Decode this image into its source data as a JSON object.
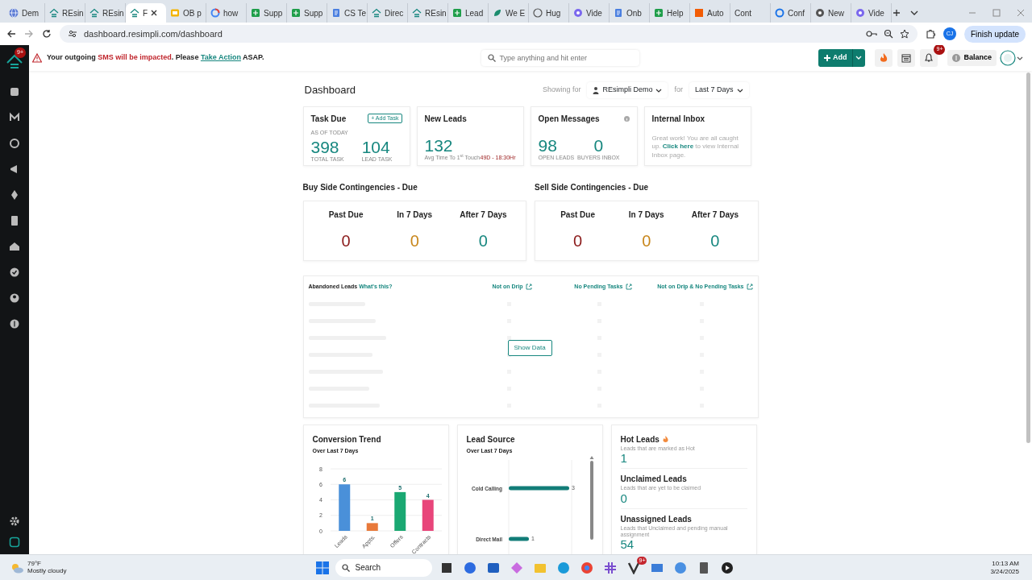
{
  "browser": {
    "tabs": [
      {
        "label": "Dem",
        "kind": "globe",
        "selected": false
      },
      {
        "label": "REsin",
        "kind": "house",
        "selected": false
      },
      {
        "label": "REsin",
        "kind": "house",
        "selected": false
      },
      {
        "label": "F",
        "kind": "house",
        "selected": true
      },
      {
        "label": "OB p",
        "kind": "slides",
        "selected": false
      },
      {
        "label": "how",
        "kind": "google",
        "selected": false
      },
      {
        "label": "Supp",
        "kind": "sheet",
        "selected": false
      },
      {
        "label": "Supp",
        "kind": "sheet",
        "selected": false
      },
      {
        "label": "CS Te",
        "kind": "doc",
        "selected": false
      },
      {
        "label": "Direc",
        "kind": "house",
        "selected": false
      },
      {
        "label": "REsin",
        "kind": "house",
        "selected": false
      },
      {
        "label": "Lead",
        "kind": "sheet",
        "selected": false
      },
      {
        "label": "We E",
        "kind": "leaf",
        "selected": false
      },
      {
        "label": "Hug",
        "kind": "face",
        "selected": false
      },
      {
        "label": "Vide",
        "kind": "flower",
        "selected": false
      },
      {
        "label": "Onb",
        "kind": "doc",
        "selected": false
      },
      {
        "label": "Help",
        "kind": "sheet",
        "selected": false
      },
      {
        "label": "Auto",
        "kind": "square",
        "selected": false
      },
      {
        "label": "Cont",
        "kind": "plain",
        "selected": false
      },
      {
        "label": "Conf",
        "kind": "ring",
        "selected": false
      },
      {
        "label": "New",
        "kind": "chrome",
        "selected": false
      },
      {
        "label": "Vide",
        "kind": "flower",
        "selected": false
      }
    ],
    "address": "dashboard.resimpli.com/dashboard",
    "profile": "CJ",
    "update_button": "Finish update"
  },
  "sidebar": {
    "badge": "9+"
  },
  "alert": {
    "before": "Your outgoing ",
    "highlight": "SMS will be impacted",
    "middle": ". Please ",
    "link": "Take Action",
    "after": " ASAP."
  },
  "header": {
    "search_placeholder": "Type anything and hit enter",
    "add_button": "Add",
    "notification_badge": "9+",
    "balance": "Balance"
  },
  "dashboard": {
    "title": "Dashboard",
    "showing_for": "Showing for",
    "account": "REsimpli Demo",
    "for": "for",
    "period": "Last 7 Days"
  },
  "summary_cards": [
    {
      "kind": "tasks",
      "title": "Task Due",
      "button": "+ Add Task",
      "subtitle": "AS OF TODAY",
      "stats": [
        {
          "value": "398",
          "label": "TOTAL TASK"
        },
        {
          "value": "104",
          "label": "LEAD TASK"
        }
      ]
    },
    {
      "kind": "leads",
      "title": "New Leads",
      "value": "132",
      "note": "Avg Time To 1$^{st}$ Touch",
      "note_value": "49D - 18:30Hr"
    },
    {
      "kind": "messages",
      "title": "Open Messages",
      "stats": [
        {
          "value": "98",
          "label": "OPEN LEADS"
        },
        {
          "value": "0",
          "label": "BUYERS INBOX"
        }
      ]
    },
    {
      "kind": "inbox",
      "title": "Internal Inbox",
      "before": "Great work! You are all caught up. ",
      "link": "Click here",
      "after": " to view Internal Inbox page."
    }
  ],
  "contingencies": [
    {
      "title": "Buy Side Contingencies - Due",
      "items": [
        {
          "label": "Past Due",
          "value": "0",
          "color": "#8b1a1a"
        },
        {
          "label": "In 7 Days",
          "value": "0",
          "color": "#c8871c"
        },
        {
          "label": "After 7 Days",
          "value": "0",
          "color": "#17877f"
        }
      ]
    },
    {
      "title": "Sell Side Contingencies - Due",
      "items": [
        {
          "label": "Past Due",
          "value": "0",
          "color": "#8b1a1a"
        },
        {
          "label": "In 7 Days",
          "value": "0",
          "color": "#c8871c"
        },
        {
          "label": "After 7 Days",
          "value": "0",
          "color": "#17877f"
        }
      ]
    }
  ],
  "abandoned": {
    "title": "Abandoned Leads",
    "help_link": "What's this?",
    "columns": [
      "Not on Drip",
      "No Pending Tasks",
      "Not on Drip & No Pending Tasks"
    ],
    "button": "Show Data"
  },
  "conversion": {
    "title": "Conversion Trend",
    "subtitle": "Over Last 7 Days",
    "chart_data": {
      "type": "bar",
      "categories": [
        "Leads",
        "Appts.",
        "Offers",
        "Contracts"
      ],
      "stacked": true,
      "grid": true,
      "data_labels": true,
      "yticks": [
        0,
        2,
        4,
        6,
        8
      ],
      "ylim": [
        0,
        8
      ],
      "series": [
        {
          "color": "#4a90d9",
          "values": [
            6,
            null,
            null,
            null
          ]
        },
        {
          "color": "#e8793a",
          "values": [
            null,
            1,
            null,
            null
          ]
        },
        {
          "color": "#1aa872",
          "values": [
            null,
            null,
            5,
            null
          ]
        },
        {
          "color": "#e8457a",
          "values": [
            null,
            null,
            null,
            4
          ]
        }
      ]
    }
  },
  "lead_source": {
    "title": "Lead Source",
    "subtitle": "Over Last 7 Days",
    "chart_data": {
      "type": "bar",
      "orientation": "horizontal",
      "grid": true,
      "data_labels": true,
      "categories": [
        "Cold Calling",
        "Direct Mail"
      ],
      "series": [
        {
          "color": "#127d78",
          "values": [
            3,
            1
          ]
        }
      ]
    }
  },
  "lead_stats": [
    {
      "title": "Hot Leads",
      "hot": true,
      "description": "Leads that are marked as Hot",
      "value": "1"
    },
    {
      "title": "Unclaimed Leads",
      "hot": false,
      "description": "Leads that are yet to be claimed",
      "value": "0"
    },
    {
      "title": "Unassigned Leads",
      "hot": false,
      "description": "Leads that Unclaimed and pending manual assignment",
      "value": "54"
    }
  ],
  "taskbar": {
    "temperature": "79°F",
    "weather": "Mostly cloudy",
    "search": "Search",
    "badge": "9+",
    "time": "10:13 AM",
    "date": "3/24/2025"
  }
}
